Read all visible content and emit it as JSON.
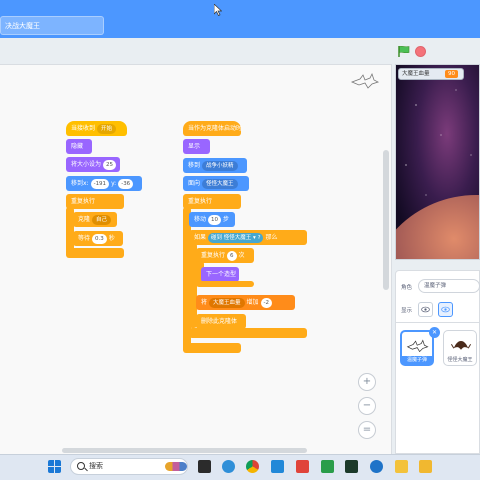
{
  "header": {
    "project_title": "决战大魔王"
  },
  "script1": {
    "hat": {
      "prefix": "当接收到",
      "message": "开始"
    },
    "show_label": "隐藏",
    "size": {
      "label": "将大小设为",
      "value": "25"
    },
    "goto": {
      "label": "移到x:",
      "x": "-191",
      "y_label": "y:",
      "y": "-36"
    },
    "forever": "重复执行",
    "clone": {
      "label": "克隆",
      "target": "自己"
    },
    "wait": {
      "label": "等待",
      "value": "0.3",
      "unit": "秒"
    }
  },
  "script2": {
    "hat": "当作为克隆体启动时",
    "show": "显示",
    "goto": {
      "label": "移到",
      "target": "战争小妖精"
    },
    "point": {
      "label": "面向",
      "target": "怪怪大魔王"
    },
    "forever": "重复执行",
    "move": {
      "label": "移动",
      "value": "10",
      "unit": "步"
    },
    "if": {
      "label": "如果",
      "touch": "碰到",
      "target": "怪怪大魔王",
      "q": "?",
      "then": "那么"
    },
    "repeat": {
      "label": "重复执行",
      "value": "6",
      "unit": "次"
    },
    "next_costume": "下一个造型",
    "change": {
      "label": "将",
      "variable": "大魔王血量",
      "by": "增加",
      "value": "-2"
    },
    "delete": "删除此克隆体"
  },
  "stage": {
    "monitor_label": "大魔王血量",
    "monitor_value": "90"
  },
  "sprite_info": {
    "name_label": "角色",
    "name_value": "温魔子弹",
    "show_label": "显示",
    "sprites": [
      {
        "name": "温魔子弹"
      },
      {
        "name": "怪怪大魔王"
      }
    ]
  },
  "zoom": {
    "in": "+",
    "out": "−",
    "reset": "="
  },
  "taskbar": {
    "search_text": "搜索"
  }
}
